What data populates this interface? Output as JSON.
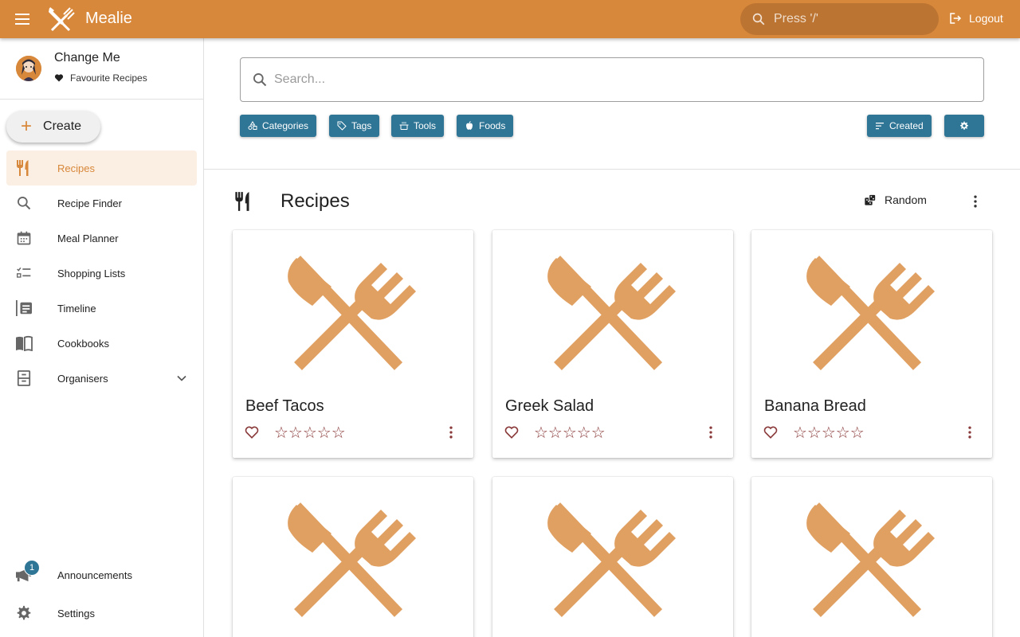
{
  "app": {
    "title": "Mealie",
    "search_placeholder": "Press '/'",
    "logout_label": "Logout"
  },
  "user": {
    "name": "Change Me",
    "favourites_label": "Favourite Recipes"
  },
  "sidebar": {
    "create_label": "Create",
    "items": [
      {
        "label": "Recipes",
        "icon": "fork-knife-icon",
        "active": true
      },
      {
        "label": "Recipe Finder",
        "icon": "search-icon"
      },
      {
        "label": "Meal Planner",
        "icon": "calendar-icon"
      },
      {
        "label": "Shopping Lists",
        "icon": "checklist-icon"
      },
      {
        "label": "Timeline",
        "icon": "timeline-icon"
      },
      {
        "label": "Cookbooks",
        "icon": "book-open-icon"
      },
      {
        "label": "Organisers",
        "icon": "cabinet-icon"
      }
    ],
    "bottom_items": [
      {
        "label": "Announcements",
        "icon": "megaphone-icon",
        "badge": "1"
      },
      {
        "label": "Settings",
        "icon": "gear-icon"
      }
    ]
  },
  "search": {
    "placeholder": "Search..."
  },
  "filters": {
    "categories": "Categories",
    "tags": "Tags",
    "tools": "Tools",
    "foods": "Foods",
    "sort": "Created"
  },
  "section": {
    "title": "Recipes",
    "random_label": "Random"
  },
  "recipes": [
    {
      "name": "Beef Tacos",
      "rating": 0
    },
    {
      "name": "Greek Salad",
      "rating": 0
    },
    {
      "name": "Banana Bread",
      "rating": 0
    },
    {
      "name": "",
      "rating": 0
    },
    {
      "name": "",
      "rating": 0
    },
    {
      "name": "",
      "rating": 0
    }
  ],
  "colors": {
    "primary": "#d8883a",
    "secondary": "#2f7595",
    "accent": "#8a3a3a",
    "placeholder_image": "#e0a062"
  }
}
